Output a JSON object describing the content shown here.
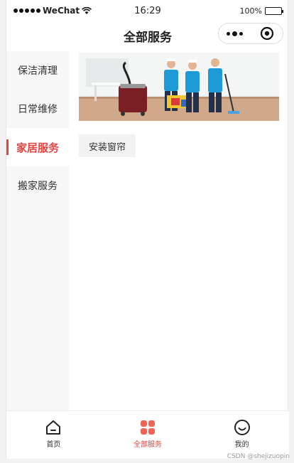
{
  "status_bar": {
    "carrier": "WeChat",
    "time": "16:29",
    "battery": "100%",
    "battery_level": 1.0
  },
  "nav": {
    "title": "全部服务"
  },
  "sidebar": {
    "items": [
      {
        "label": "保洁清理"
      },
      {
        "label": "日常维修"
      },
      {
        "label": "家居服务"
      },
      {
        "label": "搬家服务"
      }
    ],
    "active_index": 2
  },
  "main": {
    "services": [
      {
        "label": "安装窗帘"
      }
    ]
  },
  "tab_bar": {
    "items": [
      {
        "label": "首页",
        "icon": "home-icon"
      },
      {
        "label": "全部服务",
        "icon": "grid-icon"
      },
      {
        "label": "我的",
        "icon": "smile-icon"
      }
    ],
    "active_index": 1,
    "active_color": "#e64340"
  },
  "watermark": "CSDN @shejizuopin",
  "colors": {
    "accent": "#e64340"
  }
}
